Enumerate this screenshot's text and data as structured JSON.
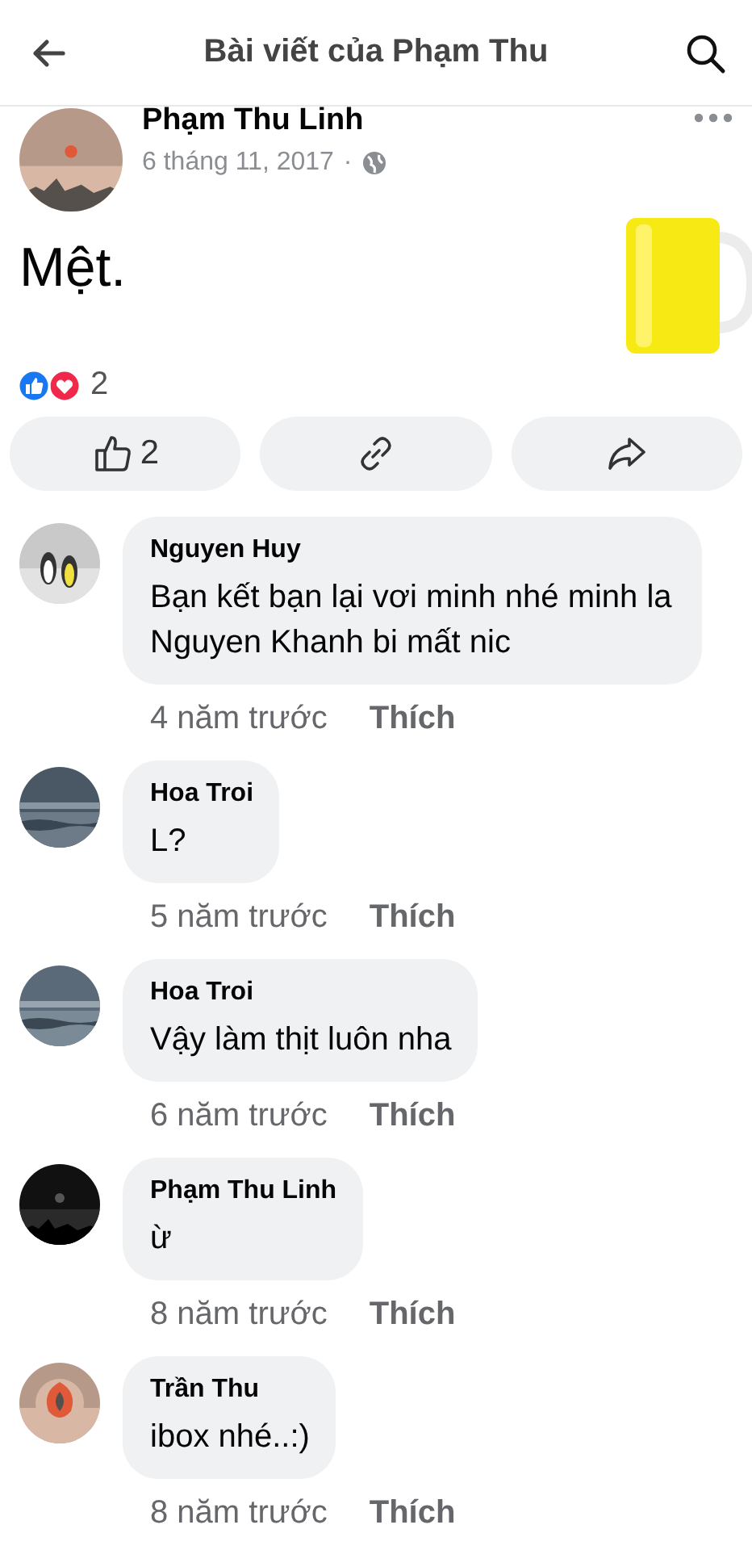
{
  "header": {
    "title": "Bài viết của Phạm Thu"
  },
  "post": {
    "author": "Phạm Thu Linh",
    "date": "6 tháng 11, 2017",
    "separator": "·",
    "text": "Mệt.",
    "reaction_count": "2"
  },
  "actions": [
    {
      "kind": "like",
      "label": "2"
    },
    {
      "kind": "link"
    },
    {
      "kind": "share"
    }
  ],
  "comments": [
    {
      "author": "Nguyen Huy",
      "text": "Bạn kết bạn lại vơi minh nhé minh la Nguyen Khanh bi mất nic",
      "time": "4 năm trước",
      "like": "Thích"
    },
    {
      "author": "Hoa Troi",
      "text": "L?",
      "time": "5 năm trước",
      "like": "Thích"
    },
    {
      "author": "Hoa Troi",
      "text": "Vậy làm thịt luôn nha",
      "time": "6 năm trước",
      "like": "Thích"
    },
    {
      "author": "Phạm Thu Linh",
      "text": "ừ",
      "time": "8 năm trước",
      "like": "Thích"
    },
    {
      "author": "Trần Thu",
      "text": "ibox nhé..:)",
      "time": "8 năm trước",
      "like": "Thích"
    }
  ]
}
